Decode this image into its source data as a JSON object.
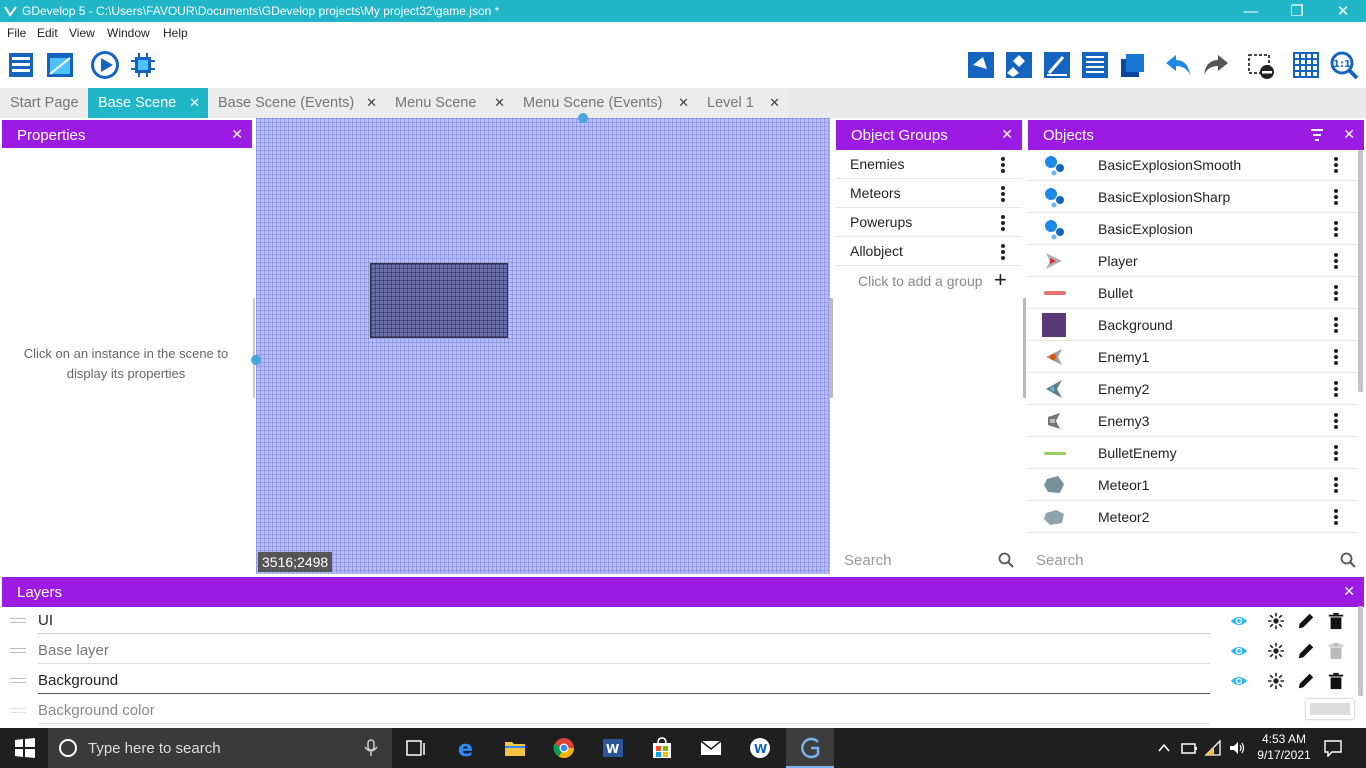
{
  "window": {
    "title": "GDevelop 5 - C:\\Users\\FAVOUR\\Documents\\GDevelop projects\\My project32\\game.json *",
    "accent": "#21b5c8",
    "panel_color": "#9c1be3"
  },
  "menu": [
    "File",
    "Edit",
    "View",
    "Window",
    "Help"
  ],
  "tabs": [
    {
      "label": "Start Page"
    },
    {
      "label": "Base Scene"
    },
    {
      "label": "Base Scene (Events)"
    },
    {
      "label": "Menu Scene"
    },
    {
      "label": "Menu Scene (Events)"
    },
    {
      "label": "Level 1"
    }
  ],
  "properties": {
    "title": "Properties",
    "message": "Click on an instance in the scene to display its properties"
  },
  "canvas": {
    "coords": "3516;2498"
  },
  "groups": {
    "title": "Object Groups",
    "items": [
      "Enemies",
      "Meteors",
      "Powerups",
      "Allobject"
    ],
    "add_label": "Click to add a group",
    "search_placeholder": "Search"
  },
  "objects": {
    "title": "Objects",
    "items": [
      "BasicExplosionSmooth",
      "BasicExplosionSharp",
      "BasicExplosion",
      "Player",
      "Bullet",
      "Background",
      "Enemy1",
      "Enemy2",
      "Enemy3",
      "BulletEnemy",
      "Meteor1",
      "Meteor2"
    ],
    "search_placeholder": "Search"
  },
  "layers": {
    "title": "Layers",
    "items": [
      "UI",
      "Base layer",
      "Background"
    ],
    "bg_color_label": "Background color"
  },
  "taskbar": {
    "search_placeholder": "Type here to search",
    "time": "4:53 AM",
    "date": "9/17/2021"
  }
}
